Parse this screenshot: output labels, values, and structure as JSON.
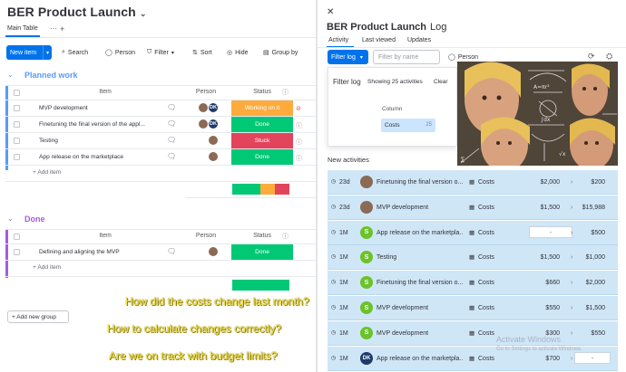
{
  "board": {
    "title": "BER Product Launch",
    "main_tab": "Main Table",
    "add_tab": "+",
    "toolbar": {
      "new_item": "New item",
      "search": "Search",
      "person": "Person",
      "filter": "Filter",
      "sort": "Sort",
      "hide": "Hide",
      "group_by": "Group by"
    },
    "groups": [
      {
        "name": "Planned work",
        "color": "#579bfc",
        "columns": [
          "Item",
          "Person",
          "Status"
        ],
        "rows": [
          {
            "item": "MVP development",
            "status": "Working on it",
            "status_color": "#fdab3d",
            "avatars": [
              "photo",
              "DK"
            ],
            "chat": "comment-plus-icon"
          },
          {
            "item": "Finetuning the final version of the appl...",
            "status": "Done",
            "status_color": "#00c875",
            "avatars": [
              "photo",
              "DK"
            ],
            "chat": "comment-2-icon"
          },
          {
            "item": "Testing",
            "status": "Stuck",
            "status_color": "#e2445c",
            "avatars": [
              "photo"
            ],
            "chat": "comment-2-icon"
          },
          {
            "item": "App release on the marketplace",
            "status": "Done",
            "status_color": "#00c875",
            "avatars": [
              "photo"
            ],
            "chat": "comment-2-icon"
          }
        ],
        "add_item": "+ Add item"
      },
      {
        "name": "Done",
        "color": "#a25ddc",
        "columns": [
          "Item",
          "Person",
          "Status"
        ],
        "rows": [
          {
            "item": "Defining and aligning the MVP",
            "status": "Done",
            "status_color": "#00c875",
            "avatars": [
              "photo"
            ],
            "chat": "comment-plus-icon"
          }
        ],
        "add_item": "+ Add item"
      }
    ],
    "add_group": "+ Add new group"
  },
  "questions": [
    "How did the costs change last month?",
    "How to calculate changes correctly?",
    "Are we on track with budget limits?"
  ],
  "log": {
    "title": "BER Product Launch",
    "subtitle": "Log",
    "tabs": [
      "Activity",
      "Last viewed",
      "Updates"
    ],
    "filter_log": "Filter log",
    "filter_placeholder": "Filter by name",
    "person": "Person",
    "popup": {
      "title": "Filter log",
      "showing": "Showing 25 activities",
      "clear": "Clear",
      "column_header": "Column",
      "option": "Costs",
      "option_count": "25"
    },
    "new_activities": "New activities",
    "rows": [
      {
        "time": "23d",
        "avatar": "photo",
        "item": "Finetuning the final version o...",
        "column": "Costs",
        "old": "$2,000",
        "new": "$200"
      },
      {
        "time": "23d",
        "avatar": "photo",
        "item": "MVP development",
        "column": "Costs",
        "old": "$1,500",
        "new": "$15,988"
      },
      {
        "time": "1M",
        "avatar": "S",
        "item": "App release on the marketpla...",
        "column": "Costs",
        "old": "-",
        "new": "$500"
      },
      {
        "time": "1M",
        "avatar": "S",
        "item": "Testing",
        "column": "Costs",
        "old": "$1,500",
        "new": "$1,000"
      },
      {
        "time": "1M",
        "avatar": "S",
        "item": "Finetuning the final version o...",
        "column": "Costs",
        "old": "$660",
        "new": "$2,000"
      },
      {
        "time": "1M",
        "avatar": "S",
        "item": "MVP development",
        "column": "Costs",
        "old": "$550",
        "new": "$1,500"
      },
      {
        "time": "1M",
        "avatar": "S",
        "item": "MVP development",
        "column": "Costs",
        "old": "$300",
        "new": "$550"
      },
      {
        "time": "1M",
        "avatar": "DK",
        "item": "App release on the marketpla...",
        "column": "Costs",
        "old": "$700",
        "new": "-"
      }
    ]
  },
  "watermark": {
    "line1": "Activate Windows",
    "line2": "Go to Settings to activate Windows."
  }
}
